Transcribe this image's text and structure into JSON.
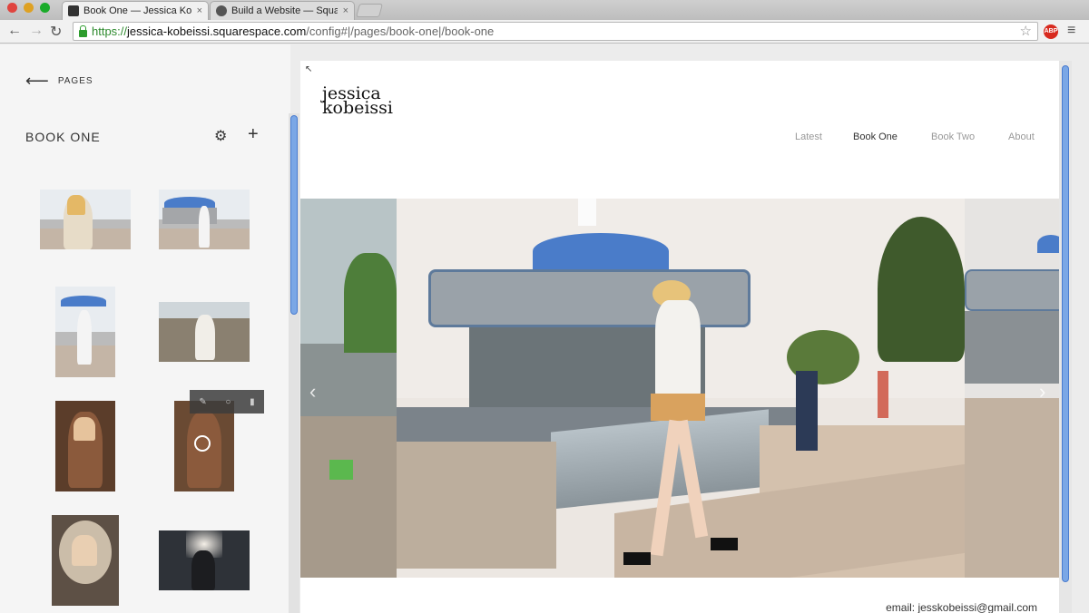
{
  "browser": {
    "tabs": [
      {
        "title": "Book One — Jessica Kobe",
        "close": "×"
      },
      {
        "title": "Build a Website — Squares",
        "close": "×"
      }
    ],
    "url": {
      "scheme": "https://",
      "host": "jessica-kobeissi.squarespace.com",
      "path": "/config#|/pages/book-one|/book-one"
    },
    "extension_label": "ABP"
  },
  "panel": {
    "back_label": "PAGES",
    "page_title": "BOOK ONE"
  },
  "site": {
    "brand_line1": "jessica",
    "brand_line2": "kobeissi",
    "nav": [
      "Latest",
      "Book One",
      "Book Two",
      "About"
    ],
    "nav_current_index": 1,
    "footer_email": "email: jesskobeissi@gmail.com"
  },
  "colors": {
    "scrollbar": "#7aa7e6",
    "carousel_roof": "#4a7cc9"
  },
  "icons": {
    "back": "arrow-left-icon",
    "settings": "gear-icon",
    "add": "plus-icon",
    "reload": "reload-icon",
    "star": "star-icon",
    "menu": "hamburger-icon"
  }
}
